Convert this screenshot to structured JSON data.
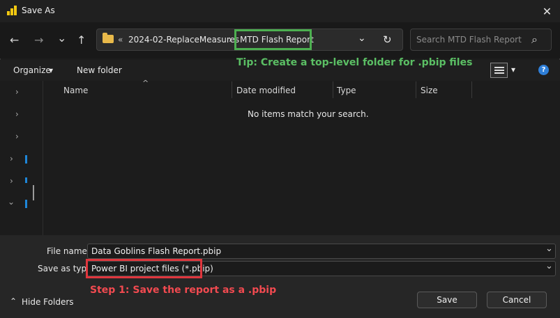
{
  "window": {
    "title": "Save As",
    "close_glyph": "✕"
  },
  "nav": {
    "back": "←",
    "forward": "→",
    "recent": "⌄",
    "up": "↑"
  },
  "address": {
    "chevrons": "«",
    "path_parent": "2024-02-ReplaceMeasures",
    "separator": "›",
    "path_current": "MTD Flash Report",
    "dropdown": "⌄",
    "refresh": "↻"
  },
  "search": {
    "placeholder": "Search MTD Flash Report",
    "icon": "⌕"
  },
  "toolbar": {
    "organize": "Organize",
    "organize_caret": "▾",
    "new_folder": "New folder",
    "view_caret": "▾",
    "help": "?"
  },
  "annotations": {
    "tip": "Tip: Create a top-level folder for .pbip files",
    "step": "Step 1: Save the report as a .pbip",
    "tip_color": "#4caf50",
    "step_color": "#e0363d"
  },
  "columns": [
    "Name",
    "Date modified",
    "Type",
    "Size"
  ],
  "sort_indicator": "^",
  "empty_message": "No items match your search.",
  "nav_pane": {
    "expand": "›",
    "collapse": "⌄"
  },
  "form": {
    "file_name_label": "File name:",
    "file_name_value": "Data Goblins Flash Report.pbip",
    "save_type_label": "Save as type:",
    "save_type_value": "Power BI project files (*.pbip)",
    "dropdown": "⌄"
  },
  "footer": {
    "hide_folders": "Hide Folders",
    "hide_caret": "⌃",
    "save": "Save",
    "cancel": "Cancel"
  }
}
